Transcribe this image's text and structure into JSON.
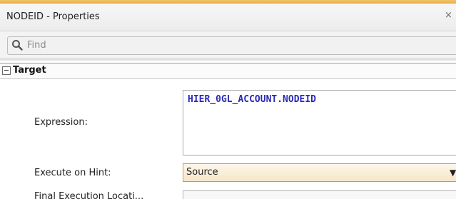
{
  "window": {
    "title": "NODEID - Properties",
    "close_glyph": "×"
  },
  "search": {
    "placeholder": "Find",
    "icon": "search-icon"
  },
  "section": {
    "title": "Target",
    "toggle_icon": "collapse-minus-icon"
  },
  "fields": {
    "expression": {
      "label": "Expression:",
      "value": "HIER_0GL_ACCOUNT.NODEID"
    },
    "execute_on_hint": {
      "label": "Execute on Hint:",
      "value": "Source",
      "arrow_icon": "dropdown-arrow-icon"
    },
    "final_execution_location": {
      "label": "Final Execution Locati..."
    }
  },
  "colors": {
    "accent": "#e8ae3f",
    "expression_text": "#2a2ab8",
    "select_border": "#c79a4a"
  }
}
